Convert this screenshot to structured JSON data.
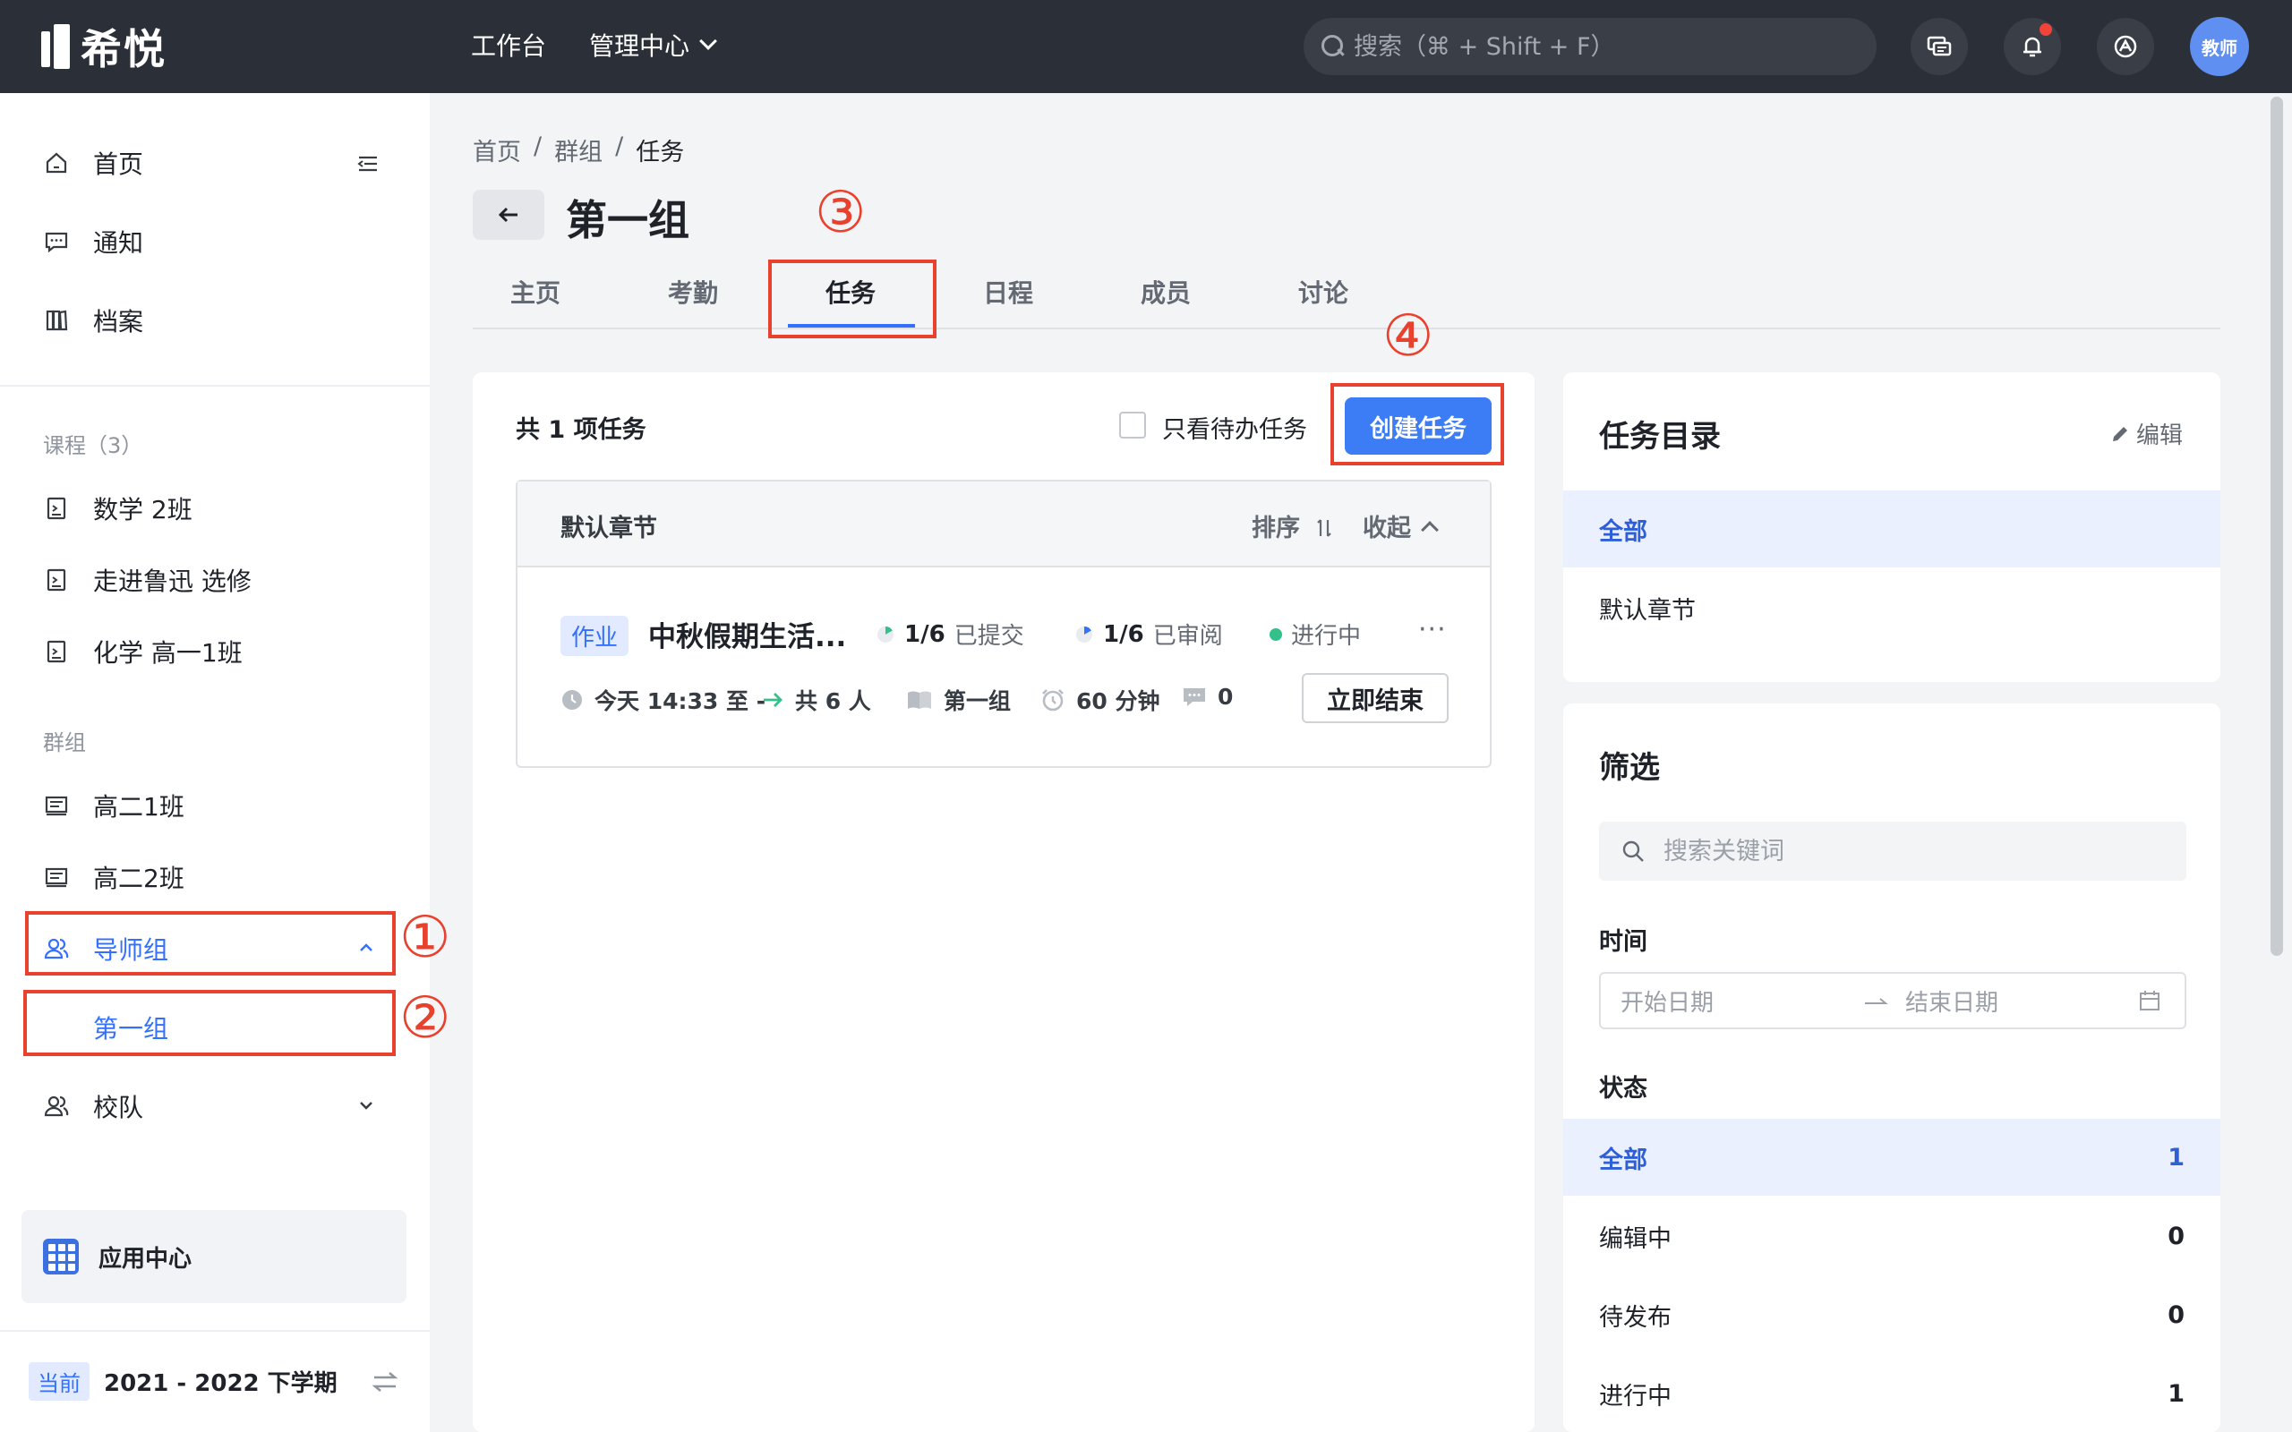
{
  "app": {
    "logo_text": "希悦"
  },
  "topnav": {
    "workbench": "工作台",
    "management": "管理中心"
  },
  "search": {
    "placeholder": "搜索（⌘ + Shift + F）"
  },
  "user": {
    "avatar_text": "教师"
  },
  "sidebar": {
    "home": "首页",
    "notice": "通知",
    "archive": "档案",
    "courses_header": "课程（3）",
    "courses": [
      "数学 2班",
      "走进鲁迅 选修",
      "化学 高一1班"
    ],
    "groups_header": "群组",
    "groups": [
      "高二1班",
      "高二2班"
    ],
    "mentor_group": "导师组",
    "first_group": "第一组",
    "school_team": "校队",
    "app_center": "应用中心",
    "term_badge": "当前",
    "term_name": "2021 - 2022 下学期"
  },
  "annotations": {
    "n1": "①",
    "n2": "②",
    "n3": "③",
    "n4": "④"
  },
  "breadcrumb": {
    "home": "首页",
    "sep": "/",
    "groups": "群组",
    "current": "任务"
  },
  "page": {
    "title": "第一组"
  },
  "tabs": [
    "主页",
    "考勤",
    "任务",
    "日程",
    "成员",
    "讨论"
  ],
  "active_tab": "任务",
  "tasks": {
    "count_label": "共 1 项任务",
    "only_todo_label": "只看待办任务",
    "create_button": "创建任务",
    "chapter": {
      "name": "默认章节",
      "sort_label": "排序",
      "fold_label": "收起"
    },
    "items": [
      {
        "type_badge": "作业",
        "title": "中秋假期生活...",
        "submitted_count": "1/6",
        "submitted_label": "已提交",
        "reviewed_count": "1/6",
        "reviewed_label": "已审阅",
        "status": "进行中",
        "more": "···",
        "time": "今天 14:33 至 -",
        "assignees": "共 6 人",
        "group": "第一组",
        "duration": "60 分钟",
        "comments": "0",
        "end_button": "立即结束"
      }
    ]
  },
  "catalog": {
    "title": "任务目录",
    "edit_label": "编辑",
    "items": [
      "全部",
      "默认章节"
    ]
  },
  "filter": {
    "title": "筛选",
    "search_placeholder": "搜索关键词",
    "time_label": "时间",
    "start_placeholder": "开始日期",
    "end_placeholder": "结束日期",
    "status_label": "状态",
    "statuses": [
      {
        "label": "全部",
        "count": "1"
      },
      {
        "label": "编辑中",
        "count": "0"
      },
      {
        "label": "待发布",
        "count": "0"
      },
      {
        "label": "进行中",
        "count": "1"
      }
    ]
  },
  "colors": {
    "accent": "#3370ff",
    "annotation": "#e8412e",
    "topbar": "#2b2f37"
  }
}
